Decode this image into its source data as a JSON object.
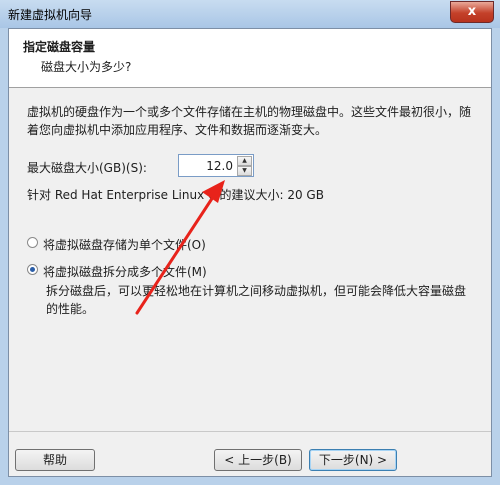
{
  "window": {
    "title": "新建虚拟机向导",
    "close_label": "x"
  },
  "header": {
    "title": "指定磁盘容量",
    "subtitle": "磁盘大小为多少?"
  },
  "description": "虚拟机的硬盘作为一个或多个文件存储在主机的物理磁盘中。这些文件最初很小，随着您向虚拟机中添加应用程序、文件和数据而逐渐变大。",
  "disk_size": {
    "label": "最大磁盘大小(GB)(S):",
    "value": "12.0"
  },
  "recommendation": "针对 Red Hat Enterprise Linux 6 的建议大小: 20 GB",
  "options": [
    {
      "label": "将虚拟磁盘存储为单个文件(O)",
      "checked": false
    },
    {
      "label": "将虚拟磁盘拆分成多个文件(M)",
      "checked": true
    }
  ],
  "split_description": "拆分磁盘后，可以更轻松地在计算机之间移动虚拟机，但可能会降低大容量磁盘的性能。",
  "buttons": {
    "help": "帮助",
    "back": "< 上一步(B)",
    "next": "下一步(N) >"
  },
  "annotation": {
    "arrow_color": "#e8231b"
  }
}
